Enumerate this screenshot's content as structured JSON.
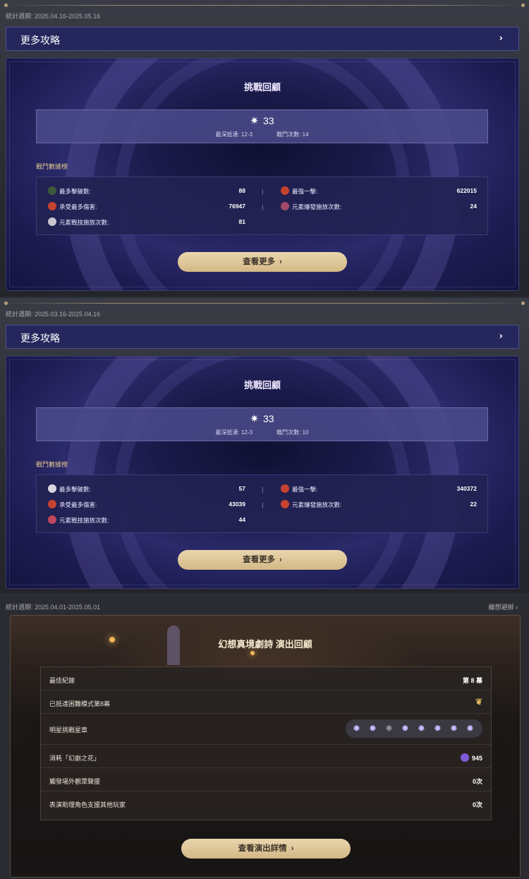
{
  "abyss": [
    {
      "period": "統計週期: 2025.04.16-2025.05.16",
      "more_label": "更多攻略",
      "title": "挑戰回顧",
      "stars": "33",
      "deepest_label": "最深抵達: 12-3",
      "battles_label": "戰鬥次數: 14",
      "rank_title": "戰鬥數據榜",
      "stats": {
        "defeats_label": "最多擊破數:",
        "defeats_value": "88",
        "strongest_label": "最強一擊:",
        "strongest_value": "622015",
        "damage_taken_label": "承受最多傷害:",
        "damage_taken_value": "76947",
        "burst_label": "元素爆發施放次數:",
        "burst_value": "24",
        "skill_label": "元素戰技施放次數:",
        "skill_value": "81"
      },
      "more_button": "查看更多"
    },
    {
      "period": "統計週期: 2025.03.16-2025.04.16",
      "more_label": "更多攻略",
      "title": "挑戰回顧",
      "stars": "33",
      "deepest_label": "最深抵達: 12-3",
      "battles_label": "戰鬥次數: 10",
      "rank_title": "戰鬥數據榜",
      "stats": {
        "defeats_label": "最多擊破數:",
        "defeats_value": "57",
        "strongest_label": "最強一擊:",
        "strongest_value": "340372",
        "damage_taken_label": "承受最多傷害:",
        "damage_taken_value": "43039",
        "burst_label": "元素爆發施放次數:",
        "burst_value": "22",
        "skill_label": "元素戰技施放次數:",
        "skill_value": "44"
      },
      "more_button": "查看更多"
    }
  ],
  "theater": {
    "period": "統計週期: 2025.04.01-2025.05.01",
    "replay_link": "繪想避辦 ›",
    "title": "幻想真境劇詩 演出回顧",
    "rows": {
      "best_label": "最佳紀錄",
      "best_value": "第 8 幕",
      "reached_label": "已抵達困難模式第8幕",
      "stars_label": "明星挑戰星章",
      "consumed_label": "消耗「幻劇之花」",
      "consumed_value": "945",
      "audience_label": "觸發場外觀眾聲援",
      "audience_value": "0次",
      "support_label": "表演助理角色支援其他玩家",
      "support_value": "0次"
    },
    "stars_earned": 7,
    "stars_total": 8,
    "detail_button": "查看演出詳情"
  }
}
